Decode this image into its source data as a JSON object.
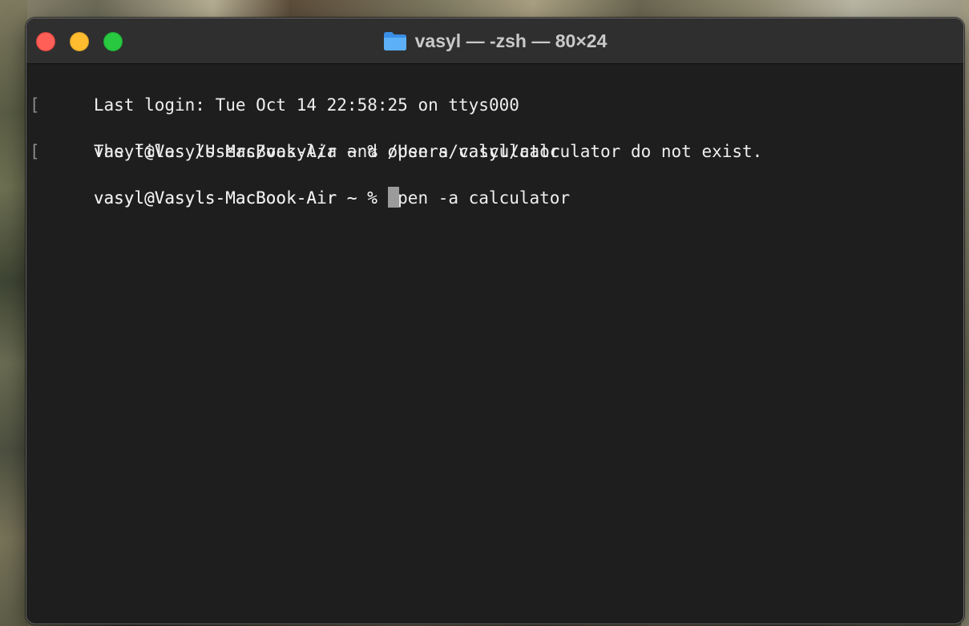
{
  "window": {
    "title": "vasyl — -zsh — 80×24",
    "folder_icon": "folder-icon"
  },
  "colors": {
    "terminal_bg": "#1e1e1e",
    "titlebar_bg": "#2f2f2f",
    "text": "#efefef",
    "close": "#ff5f57",
    "minimize": "#febc2e",
    "zoom": "#28c840",
    "cursor": "#9b9b9b"
  },
  "terminal": {
    "lines": [
      {
        "text": "Last login: Tue Oct 14 22:58:25 on ttys000",
        "marked": false
      },
      {
        "text": "vasyl@Vasyls-MacBook-Air ~ % open a calculator",
        "marked": true
      },
      {
        "text": "The files /Users/vasyl/a and /Users/vasyl/calculator do not exist.",
        "marked": false
      },
      {
        "text": "vasyl@Vasyls-MacBook-Air ~ % open -a calculator",
        "marked": true
      }
    ],
    "prompt": "vasyl@Vasyls-MacBook-Air ~ % ",
    "marker_left": "[",
    "marker_right": "]"
  }
}
